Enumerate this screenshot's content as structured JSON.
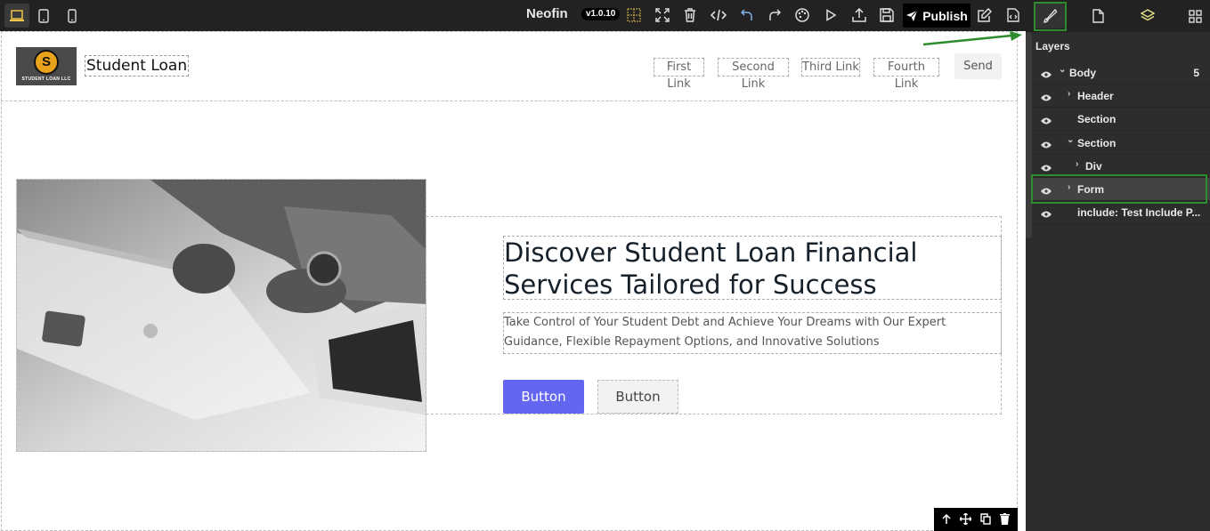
{
  "toolbar": {
    "brand": "Neofin",
    "version": "v1.0.10",
    "publish_label": "Publish",
    "devices": [
      "desktop-icon",
      "tablet-icon",
      "mobile-icon"
    ],
    "tools": [
      "grid-icon",
      "fullscreen-icon",
      "trash-icon",
      "code-icon",
      "undo-icon",
      "redo-icon",
      "palette-icon",
      "play-icon",
      "upload-icon",
      "save-icon",
      "edit-icon",
      "export-code-icon"
    ]
  },
  "panel": {
    "tabs": [
      "style-manager-icon",
      "page-icon",
      "layers-icon",
      "blocks-icon"
    ],
    "title": "Layers",
    "layers": [
      {
        "name": "Body",
        "count": "5",
        "expanded": true
      },
      {
        "name": "Header",
        "expanded": false
      },
      {
        "name": "Section"
      },
      {
        "name": "Section",
        "expanded": true
      },
      {
        "name": "Div",
        "expanded": false
      },
      {
        "name": "Form",
        "expanded": false,
        "selected": true
      },
      {
        "name": "include: Test Include P..."
      }
    ]
  },
  "site": {
    "logo_text": "STUDENT LOAN LLC",
    "logo_letter": "S",
    "title": "Student Loan",
    "nav": [
      "First Link",
      "Second Link",
      "Third Link",
      "Fourth Link"
    ],
    "send_label": "Send"
  },
  "hero": {
    "heading": "Discover Student Loan Financial Services Tailored for Success",
    "subtext": "Take Control of Your Student Debt and Achieve Your Dreams with Our Expert Guidance, Flexible Repayment Options, and Innovative Solutions",
    "primary_button": "Button",
    "secondary_button": "Button"
  },
  "colors": {
    "accent": "#6366f1",
    "highlight": "#2e8b2e",
    "logo_gold": "#e8a21b"
  }
}
